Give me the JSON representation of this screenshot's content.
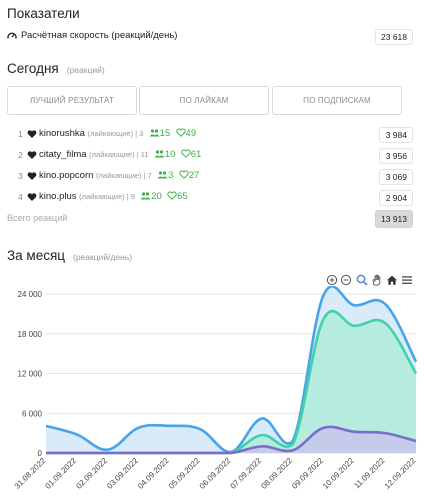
{
  "indicators": {
    "title": "Показатели",
    "speed_label": "Расчётная скорость (реакций/день)",
    "speed_value": "23 618"
  },
  "today": {
    "title": "Сегодня",
    "subtitle": "(реакций)",
    "tabs": [
      "ЛУЧШИЙ РЕЗУЛЬТАТ",
      "ПО ЛАЙКАМ",
      "ПО ПОДПИСКАМ"
    ],
    "rows": [
      {
        "num": "1",
        "name": "kinorushka",
        "tag": "(лайкающие) | 3",
        "subs": "15",
        "likes": "49",
        "value": "3 984"
      },
      {
        "num": "2",
        "name": "citaty_filma",
        "tag": "(лайкающие) | 11",
        "subs": "10",
        "likes": "61",
        "value": "3 956"
      },
      {
        "num": "3",
        "name": "kino.popcorn",
        "tag": "(лайкающие) | 7",
        "subs": "3",
        "likes": "27",
        "value": "3 069"
      },
      {
        "num": "4",
        "name": "kino.plus",
        "tag": "(лайкающие) | 9",
        "subs": "20",
        "likes": "65",
        "value": "2 904"
      }
    ],
    "total_label": "Всего реакций",
    "total_value": "13 913"
  },
  "month": {
    "title": "За месяц",
    "subtitle": "(реакций/день)"
  },
  "toolbar_icons": [
    "zoom-in-icon",
    "zoom-out-icon",
    "magnifier-icon",
    "pan-hand-icon",
    "home-icon",
    "menu-icon"
  ],
  "colors": {
    "accent_green": "#3fb049",
    "series_blue": "#47a3ea",
    "series_teal": "#3fd3a6",
    "series_purple": "#7c6ccc",
    "toolbar_blue": "#5a8ed6"
  },
  "chart_data": {
    "type": "area",
    "title": "",
    "x": [
      "31.08.2022",
      "01.09.2022",
      "02.09.2022",
      "03.09.2022",
      "04.09.2022",
      "05.09.2022",
      "06.09.2022",
      "07.09.2022",
      "08.09.2022",
      "09.09.2022",
      "10.09.2022",
      "11.09.2022",
      "12.09.2022"
    ],
    "ylim": [
      0,
      24000
    ],
    "yticks": [
      "24 000",
      "18 000",
      "12 000",
      "6 000",
      "0"
    ],
    "series": [
      {
        "name": "",
        "color": "#47a3ea",
        "values": [
          4100,
          2800,
          500,
          3800,
          4100,
          3600,
          150,
          5200,
          1800,
          23800,
          22300,
          22500,
          13800
        ]
      },
      {
        "name": "",
        "color": "#3fd3a6",
        "values": [
          0,
          0,
          0,
          0,
          0,
          0,
          0,
          2700,
          1300,
          20200,
          19200,
          19600,
          12000
        ]
      },
      {
        "name": "",
        "color": "#7c6ccc",
        "values": [
          0,
          0,
          0,
          0,
          0,
          0,
          0,
          1000,
          400,
          3800,
          3200,
          3000,
          1800
        ]
      }
    ]
  }
}
